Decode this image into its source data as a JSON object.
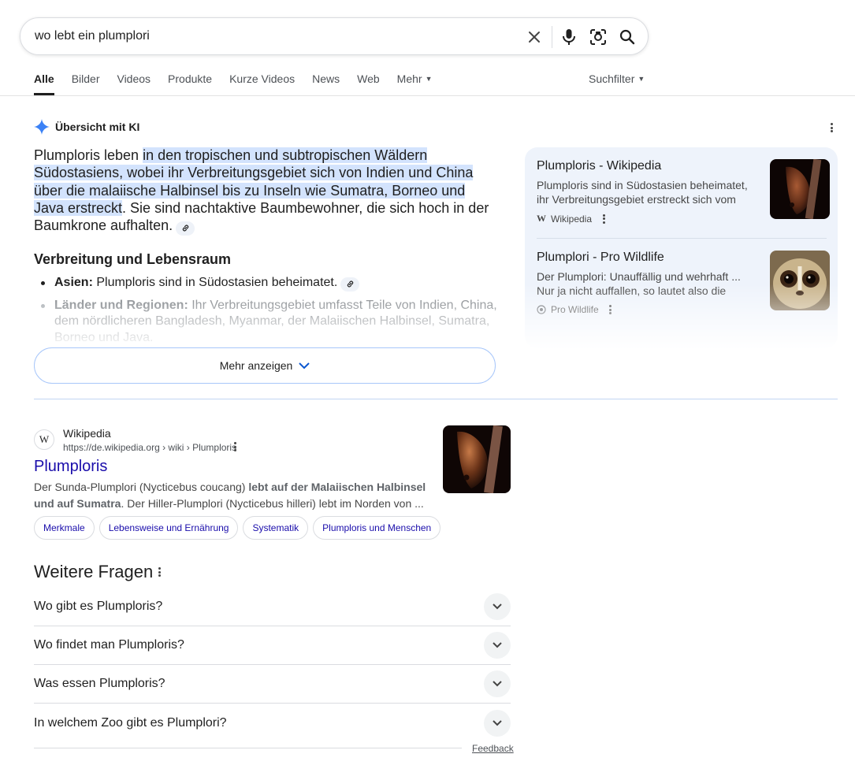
{
  "search": {
    "query": "wo lebt ein plumplori"
  },
  "tabs": [
    "Alle",
    "Bilder",
    "Videos",
    "Produkte",
    "Kurze Videos",
    "News",
    "Web",
    "Mehr"
  ],
  "suchfilter_label": "Suchfilter",
  "ai_overview": {
    "label": "Übersicht mit KI",
    "summary_plain": "Plumploris leben ",
    "summary_highlight": "in den tropischen und subtropischen Wäldern Südostasiens, wobei ihr Verbreitungsgebiet sich von Indien und China über die malaiische Halbinsel bis zu Inseln wie Sumatra, Borneo und Java erstreckt",
    "summary_tail": ". Sie sind nachtaktive Baumbewohner, die sich hoch in der Baumkrone aufhalten.",
    "subheading": "Verbreitung und Lebensraum",
    "bullets": [
      {
        "term": "Asien:",
        "text": " Plumploris sind in Südostasien beheimatet."
      },
      {
        "term": "Länder und Regionen:",
        "text": " Ihr Verbreitungsgebiet umfasst Teile von Indien, China, dem nördlicheren Bangladesh, Myanmar, der Malaiischen Halbinsel, Sumatra, Borneo und Java."
      }
    ],
    "show_more_label": "Mehr anzeigen",
    "sources": [
      {
        "title": "Plumploris - Wikipedia",
        "snippet": "Plumploris sind in Südostasien beheimatet, ihr Verbreitungsgebiet erstreckt sich vom östlichen Indien...",
        "site": "Wikipedia"
      },
      {
        "title": "Plumplori - Pro Wildlife",
        "snippet": "Der Plumplori: Unauffällig und wehrhaft ... Nur ja nicht auffallen, so lautet also die Devise. ...",
        "site": "Pro Wildlife"
      }
    ]
  },
  "result": {
    "site": "Wikipedia",
    "url": "https://de.wikipedia.org › wiki › Plumploris",
    "title": "Plumploris",
    "snippet_a": "Der Sunda-Plumplori (Nycticebus coucang) ",
    "snippet_bold": "lebt auf der Malaiischen Halbinsel und auf Sumatra",
    "snippet_b": ". Der Hiller-Plumplori (Nycticebus hilleri) lebt im Norden von ...",
    "chips": [
      "Merkmale",
      "Lebensweise und Ernährung",
      "Systematik",
      "Plumploris und Menschen"
    ]
  },
  "paa": {
    "heading": "Weitere Fragen",
    "questions": [
      "Wo gibt es Plumploris?",
      "Wo findet man Plumploris?",
      "Was essen Plumploris?",
      "In welchem Zoo gibt es Plumplori?"
    ]
  },
  "feedback_label": "Feedback",
  "colors": {
    "link": "#1a0dab",
    "highlight": "#d3e3fd",
    "side_panel_bg": "#eef3fb",
    "show_more_border": "#a8c7fa"
  }
}
